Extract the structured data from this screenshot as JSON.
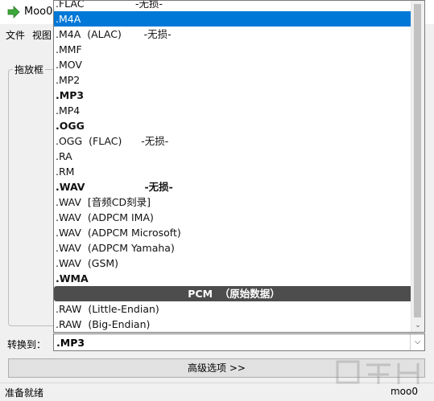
{
  "window": {
    "title": "Moo0"
  },
  "menu": {
    "file": "文件",
    "view": "视图"
  },
  "group_label": "拖放框",
  "convert_label": "转换到：",
  "selected_format": ".MP3",
  "advanced_button": "高级选项 >>",
  "status": {
    "left": "准备就绪",
    "right": "moo0"
  },
  "options": [
    {
      "text": ".FLAC                -无损-",
      "bold": false,
      "selected": false,
      "header": false
    },
    {
      "text": ".M4A",
      "bold": false,
      "selected": true,
      "header": false
    },
    {
      "text": ".M4A  (ALAC)       -无损-",
      "bold": false,
      "selected": false,
      "header": false
    },
    {
      "text": ".MMF",
      "bold": false,
      "selected": false,
      "header": false
    },
    {
      "text": ".MOV",
      "bold": false,
      "selected": false,
      "header": false
    },
    {
      "text": ".MP2",
      "bold": false,
      "selected": false,
      "header": false
    },
    {
      "text": ".MP3",
      "bold": true,
      "selected": false,
      "header": false
    },
    {
      "text": ".MP4",
      "bold": false,
      "selected": false,
      "header": false
    },
    {
      "text": ".OGG",
      "bold": true,
      "selected": false,
      "header": false
    },
    {
      "text": ".OGG  (FLAC)      -无损-",
      "bold": false,
      "selected": false,
      "header": false
    },
    {
      "text": ".RA",
      "bold": false,
      "selected": false,
      "header": false
    },
    {
      "text": ".RM",
      "bold": false,
      "selected": false,
      "header": false
    },
    {
      "text": ".WAV                 -无损-",
      "bold": true,
      "selected": false,
      "header": false
    },
    {
      "text": ".WAV  [音频CD刻录]",
      "bold": false,
      "selected": false,
      "header": false
    },
    {
      "text": ".WAV  (ADPCM IMA)",
      "bold": false,
      "selected": false,
      "header": false
    },
    {
      "text": ".WAV  (ADPCM Microsoft)",
      "bold": false,
      "selected": false,
      "header": false
    },
    {
      "text": ".WAV  (ADPCM Yamaha)",
      "bold": false,
      "selected": false,
      "header": false
    },
    {
      "text": ".WAV  (GSM)",
      "bold": false,
      "selected": false,
      "header": false
    },
    {
      "text": ".WMA",
      "bold": true,
      "selected": false,
      "header": false
    },
    {
      "text": "PCM  （原始数据）",
      "bold": true,
      "selected": false,
      "header": true
    },
    {
      "text": ".RAW  (Little-Endian)",
      "bold": false,
      "selected": false,
      "header": false
    },
    {
      "text": ".RAW  (Big-Endian)",
      "bold": false,
      "selected": false,
      "header": false
    }
  ],
  "icons": {
    "app": "arrow-right-icon",
    "dropdown": "chevron-down-icon",
    "scroll_down": "scroll-down-arrow-icon"
  },
  "colors": {
    "selection": "#0078d7",
    "section_header": "#4d4d4d",
    "app_icon": "#3aa83a"
  }
}
